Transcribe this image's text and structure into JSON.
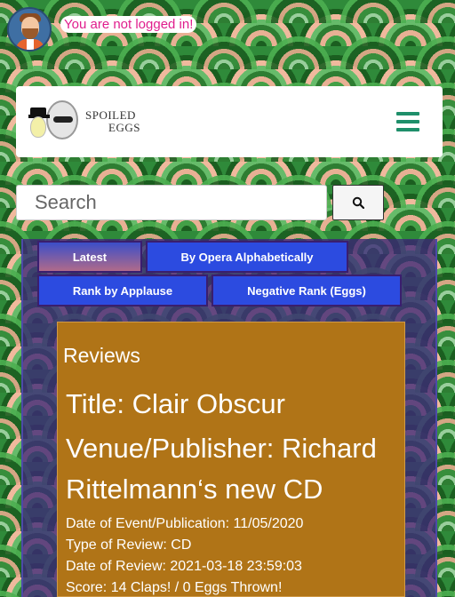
{
  "top": {
    "login_status": "You are not logged in!"
  },
  "header": {
    "brand_line1": "SPOILED",
    "brand_line2": "EGGS"
  },
  "search": {
    "placeholder": "Search"
  },
  "tabs": [
    {
      "label": "Latest"
    },
    {
      "label": "By Opera Alphabetically"
    },
    {
      "label": "Rank by Applause"
    },
    {
      "label": "Negative Rank (Eggs)"
    }
  ],
  "review": {
    "section_title": "Reviews",
    "title": "Title: Clair Obscur",
    "venue": "Venue/Publisher: Richard Rittelmann‘s new CD",
    "date_of_event": "Date of Event/Publication: 11/05/2020",
    "type": "Type of Review: CD",
    "date_of_review": "Date of Review: 2021-03-18 23:59:03",
    "score": "Score: 14 Claps! / 0 Eggs Thrown!"
  },
  "colors": {
    "accent_pink": "#e01e8d",
    "menu_green": "#1f8f6a",
    "tab_blue": "#2c4be0",
    "card_gold": "#b07417"
  }
}
